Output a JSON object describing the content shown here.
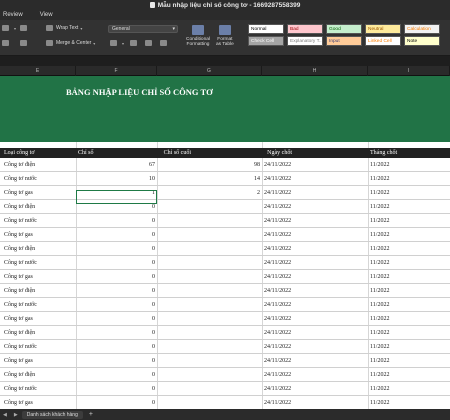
{
  "window": {
    "title": "Mẫu nhập liệu chỉ số công tơ - 1669287558399"
  },
  "menu": {
    "tabs": [
      "Review",
      "View"
    ]
  },
  "ribbon": {
    "wrap_text": "Wrap Text",
    "merge_center": "Merge & Center",
    "number_format": "General",
    "conditional_formatting_1": "Conditional",
    "conditional_formatting_2": "Formatting",
    "format_table_1": "Format",
    "format_table_2": "as Table",
    "cell_styles": [
      {
        "label": "Normal",
        "bg": "#ffffff",
        "fg": "#000000"
      },
      {
        "label": "Bad",
        "bg": "#ffc7ce",
        "fg": "#9c0006"
      },
      {
        "label": "Good",
        "bg": "#c6efce",
        "fg": "#006100"
      },
      {
        "label": "Neutral",
        "bg": "#ffeb9c",
        "fg": "#9c5700"
      },
      {
        "label": "Calculation",
        "bg": "#f2f2f2",
        "fg": "#fa7d00"
      },
      {
        "label": "Check Cell",
        "bg": "#a5a5a5",
        "fg": "#ffffff"
      },
      {
        "label": "Explanatory T...",
        "bg": "#ffffff",
        "fg": "#7f7f7f"
      },
      {
        "label": "Input",
        "bg": "#ffcc99",
        "fg": "#3f3f76"
      },
      {
        "label": "Linked Cell",
        "bg": "#ffffff",
        "fg": "#fa7d00"
      },
      {
        "label": "Note",
        "bg": "#ffffcc",
        "fg": "#000000"
      }
    ]
  },
  "columns": [
    "E",
    "F",
    "G",
    "H",
    "I"
  ],
  "sheet": {
    "banner_title": "BẢNG NHẬP LIỆU CHỈ SỐ CÔNG TƠ",
    "accent": "#217346",
    "headers": [
      "Loại công tơ",
      "Chỉ số",
      "Chỉ số cuối",
      "Ngày chốt",
      "Tháng chốt"
    ],
    "rows": [
      {
        "type": "Công tơ điện",
        "start": "67",
        "end": "98",
        "date": "24/11/2022",
        "month": "11/2022"
      },
      {
        "type": "Công tơ nước",
        "start": "10",
        "end": "14",
        "date": "24/11/2022",
        "month": "11/2022"
      },
      {
        "type": "Công tơ gas",
        "start": "1",
        "end": "2",
        "date": "24/11/2022",
        "month": "11/2022"
      },
      {
        "type": "Công tơ điện",
        "start": "0",
        "end": "",
        "date": "24/11/2022",
        "month": "11/2022"
      },
      {
        "type": "Công tơ nước",
        "start": "0",
        "end": "",
        "date": "24/11/2022",
        "month": "11/2022"
      },
      {
        "type": "Công tơ gas",
        "start": "0",
        "end": "",
        "date": "24/11/2022",
        "month": "11/2022"
      },
      {
        "type": "Công tơ điện",
        "start": "0",
        "end": "",
        "date": "24/11/2022",
        "month": "11/2022"
      },
      {
        "type": "Công tơ nước",
        "start": "0",
        "end": "",
        "date": "24/11/2022",
        "month": "11/2022"
      },
      {
        "type": "Công tơ gas",
        "start": "0",
        "end": "",
        "date": "24/11/2022",
        "month": "11/2022"
      },
      {
        "type": "Công tơ điện",
        "start": "0",
        "end": "",
        "date": "24/11/2022",
        "month": "11/2022"
      },
      {
        "type": "Công tơ nước",
        "start": "0",
        "end": "",
        "date": "24/11/2022",
        "month": "11/2022"
      },
      {
        "type": "Công tơ gas",
        "start": "0",
        "end": "",
        "date": "24/11/2022",
        "month": "11/2022"
      },
      {
        "type": "Công tơ điện",
        "start": "0",
        "end": "",
        "date": "24/11/2022",
        "month": "11/2022"
      },
      {
        "type": "Công tơ nước",
        "start": "0",
        "end": "",
        "date": "24/11/2022",
        "month": "11/2022"
      },
      {
        "type": "Công tơ gas",
        "start": "0",
        "end": "",
        "date": "24/11/2022",
        "month": "11/2022"
      },
      {
        "type": "Công tơ điện",
        "start": "0",
        "end": "",
        "date": "24/11/2022",
        "month": "11/2022"
      },
      {
        "type": "Công tơ nước",
        "start": "0",
        "end": "",
        "date": "24/11/2022",
        "month": "11/2022"
      },
      {
        "type": "Công tơ gas",
        "start": "0",
        "end": "",
        "date": "24/11/2022",
        "month": "11/2022"
      }
    ]
  },
  "sheet_tab": "Danh sách khách hàng",
  "add_sheet": "+"
}
